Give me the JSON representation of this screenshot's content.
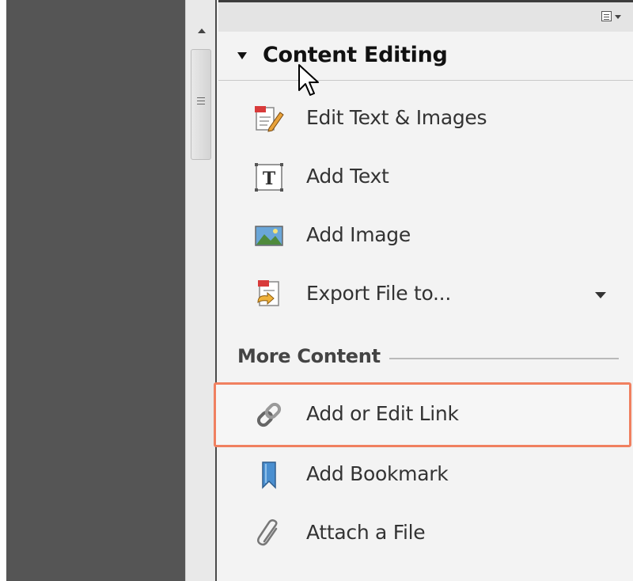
{
  "panel": {
    "section_title": "Content Editing",
    "items": [
      {
        "label": "Edit Text & Images",
        "icon": "edit-text-images-icon"
      },
      {
        "label": "Add Text",
        "icon": "add-text-icon"
      },
      {
        "label": "Add Image",
        "icon": "add-image-icon"
      },
      {
        "label": "Export File to...",
        "icon": "export-file-icon"
      }
    ],
    "more_content_label": "More Content",
    "more_items": [
      {
        "label": "Add or Edit Link",
        "icon": "link-icon",
        "highlighted": true
      },
      {
        "label": "Add Bookmark",
        "icon": "bookmark-icon"
      },
      {
        "label": "Attach a File",
        "icon": "paperclip-icon"
      }
    ]
  },
  "colors": {
    "highlight_border": "#f08060",
    "document_background": "#555555",
    "panel_background": "#f3f3f3"
  }
}
